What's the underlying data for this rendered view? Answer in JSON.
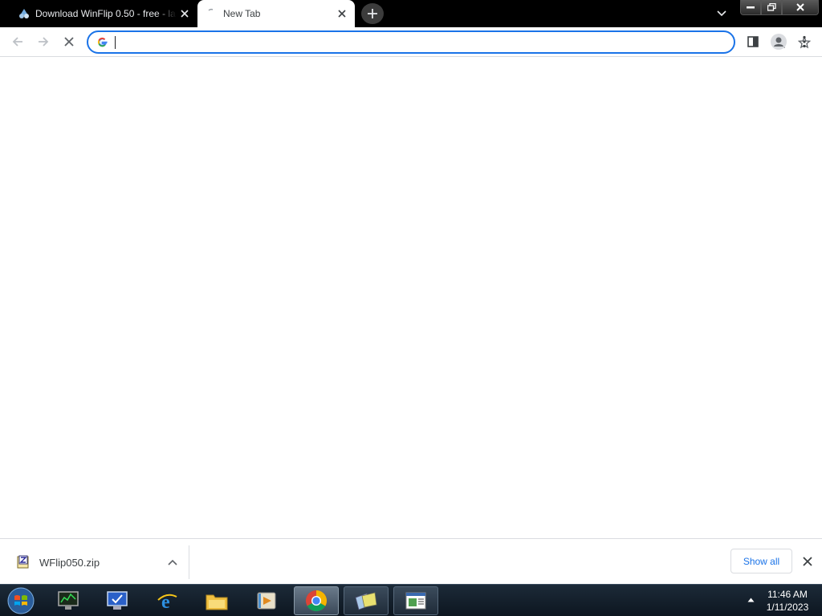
{
  "browser": {
    "tabs": [
      {
        "title": "Download WinFlip 0.50 - free - la",
        "favicon": "softpedia-icon",
        "active": false
      },
      {
        "title": "New Tab",
        "favicon": "loading-icon",
        "active": true
      }
    ],
    "omnibox": {
      "value": "",
      "placeholder": ""
    }
  },
  "download_shelf": {
    "items": [
      {
        "filename": "WFlip050.zip",
        "icon": "zip-file-icon"
      }
    ],
    "show_all_label": "Show all"
  },
  "taskbar": {
    "apps": [
      {
        "name": "resource-monitor",
        "icon": "monitor-chart-icon"
      },
      {
        "name": "task-manager",
        "icon": "checklist-icon"
      },
      {
        "name": "internet-explorer",
        "icon": "ie-icon"
      },
      {
        "name": "windows-explorer",
        "icon": "folder-icon"
      },
      {
        "name": "media-player",
        "icon": "media-icon"
      },
      {
        "name": "google-chrome",
        "icon": "chrome-icon"
      },
      {
        "name": "winflip",
        "icon": "winflip-icon"
      },
      {
        "name": "text-window",
        "icon": "window-icon"
      }
    ],
    "clock": {
      "time": "11:46 AM",
      "date": "1/11/2023"
    }
  },
  "colors": {
    "accent": "#1a73e8",
    "tabstrip": "#000000",
    "taskbar": "#0d1620"
  }
}
